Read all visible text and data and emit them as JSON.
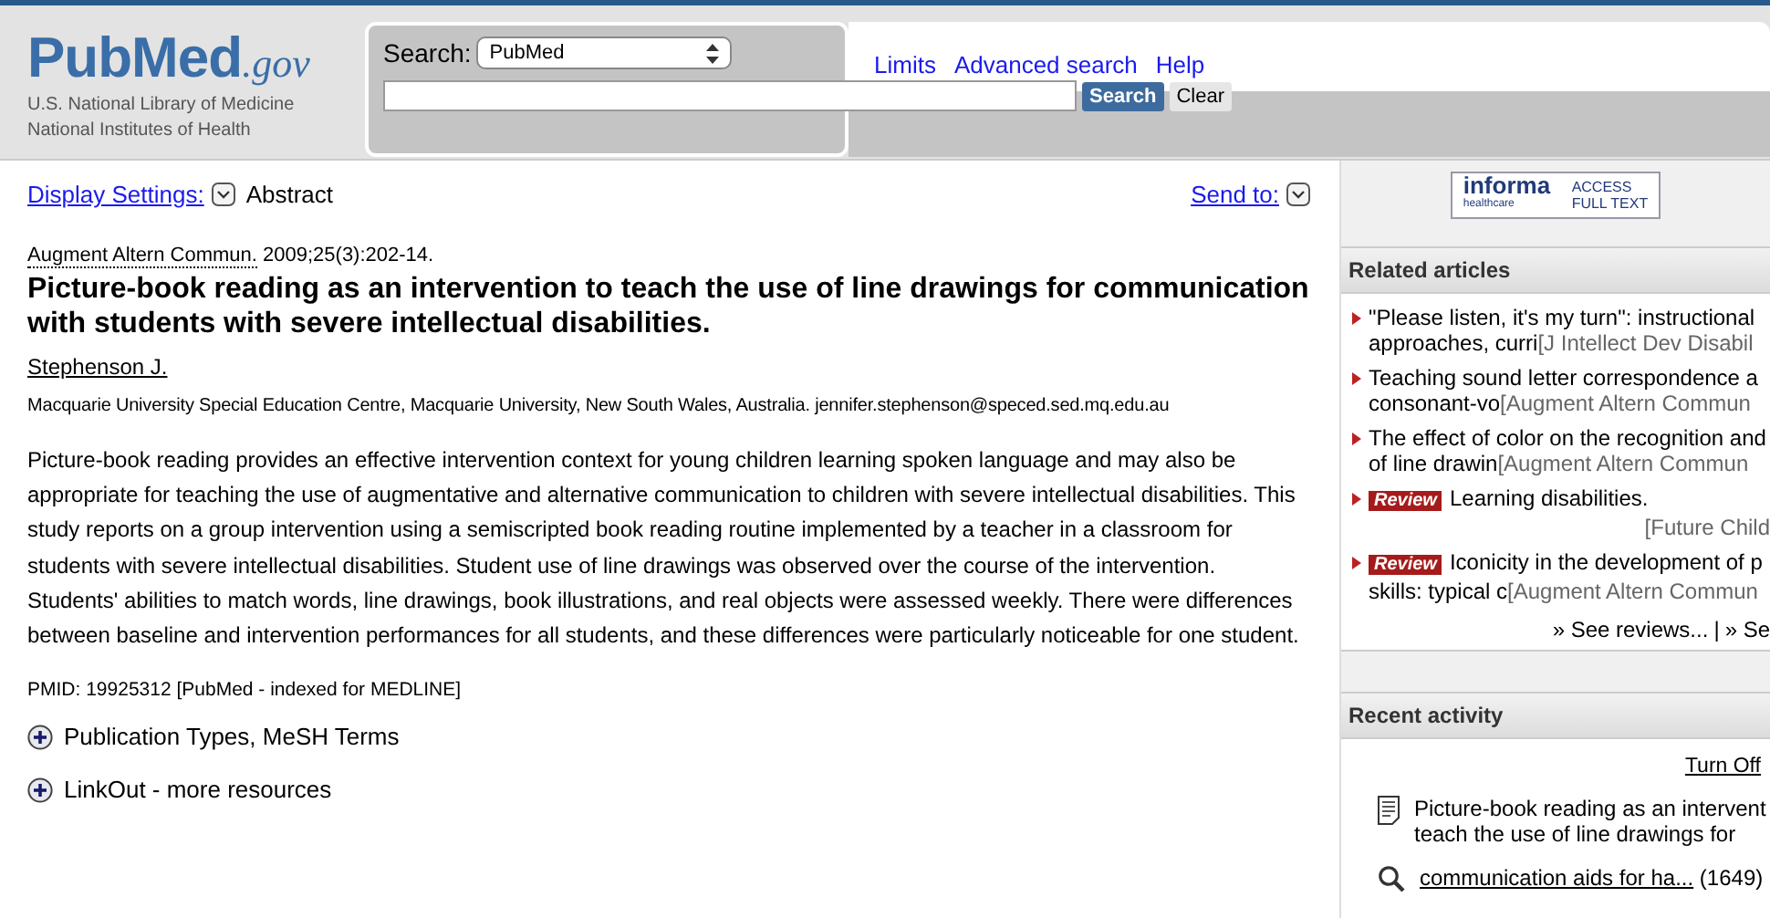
{
  "header": {
    "logo_text": "PubMed",
    "logo_suffix": ".gov",
    "org_lines": [
      "U.S. National Library of Medicine",
      "National Institutes of Health"
    ],
    "search_label": "Search:",
    "database": "PubMed",
    "search_button": "Search",
    "clear_button": "Clear",
    "links": [
      "Limits",
      "Advanced search",
      "Help"
    ]
  },
  "display_bar": {
    "settings_link": "Display Settings:",
    "format": "Abstract",
    "send_to": "Send to:"
  },
  "citation": {
    "journal": "Augment Altern Commun.",
    "details": "2009;25(3):202-14."
  },
  "title": "Picture-book reading as an intervention to teach the use of line drawings for communication with students with severe intellectual disabilities.",
  "author": "Stephenson J.",
  "affiliation": "Macquarie University Special Education Centre, Macquarie University, New South Wales, Australia. jennifer.stephenson@speced.sed.mq.edu.au",
  "abstract": "Picture-book reading provides an effective intervention context for young children learning spoken language and may also be appropriate for teaching the use of augmentative and alternative communication to children with severe intellectual disabilities. This study reports on a group intervention using a semiscripted book reading routine implemented by a teacher in a classroom for students with severe intellectual disabilities. Student use of line drawings was observed over the course of the intervention. Students' abilities to match words, line drawings, book illustrations, and real objects were assessed weekly. There were differences between baseline and intervention performances for all students, and these differences were particularly noticeable for one student.",
  "pmid": "PMID: 19925312 [PubMed - indexed for MEDLINE]",
  "expanders": [
    {
      "label": "Publication Types, MeSH Terms",
      "expanded": false
    },
    {
      "label": "LinkOut - more resources",
      "expanded": false
    }
  ],
  "full_text_badge": {
    "brand": "informa",
    "sub": "healthcare",
    "line1": "ACCESS",
    "line2": "FULL TEXT"
  },
  "related_articles": {
    "heading": "Related articles",
    "items": [
      {
        "review": false,
        "title_lines": [
          "\"Please listen, it's my turn\": instructional",
          "approaches, curri"
        ],
        "journal": "[J Intellect Dev Disabil"
      },
      {
        "review": false,
        "title_lines": [
          "Teaching sound letter correspondence a",
          "consonant-vo"
        ],
        "journal": "[Augment Altern Commun"
      },
      {
        "review": false,
        "title_lines": [
          "The effect of color on the recognition and",
          "of line drawin"
        ],
        "journal": "[Augment Altern Commun"
      },
      {
        "review": true,
        "badge": "Review",
        "title_lines": [
          "Learning disabilities."
        ],
        "journal": "[Future Child"
      },
      {
        "review": true,
        "badge": "Review",
        "title_lines": [
          "Iconicity in the development of p",
          "skills: typical c"
        ],
        "journal": "[Augment Altern Commun"
      }
    ],
    "footer_links": [
      "» See reviews...",
      "» Se"
    ],
    "footer_separator": "|"
  },
  "recent_activity": {
    "heading": "Recent activity",
    "turn_off": "Turn Off",
    "items": [
      {
        "kind": "document",
        "text_lines": [
          "Picture-book reading as an intervent",
          "teach the use of line drawings for"
        ]
      },
      {
        "kind": "search",
        "text": "communication aids for ha...",
        "count": "(1649)"
      }
    ]
  }
}
